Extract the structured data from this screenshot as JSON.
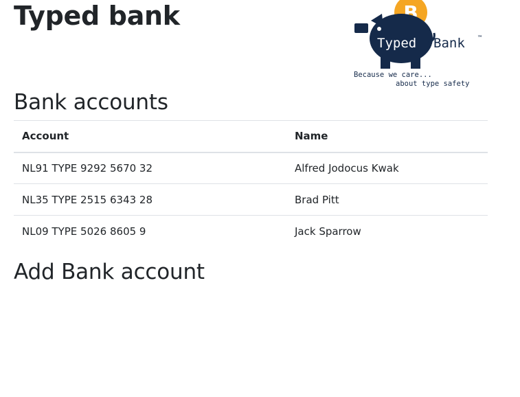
{
  "header": {
    "title": "Typed bank"
  },
  "logo": {
    "coin_symbol": "B",
    "brand_word_1": "Typed",
    "brand_word_2": "Bank",
    "trademark": "™",
    "tagline_line_1": "Because we care...",
    "tagline_line_2": "about type safety",
    "colors": {
      "pig": "#152a4a",
      "coin": "#f5a623"
    }
  },
  "accounts": {
    "title": "Bank accounts",
    "columns": [
      "Account",
      "Name"
    ],
    "rows": [
      {
        "account": "NL91 TYPE 9292 5670 32",
        "name": "Alfred Jodocus Kwak"
      },
      {
        "account": "NL35 TYPE 2515 6343 28",
        "name": "Brad Pitt"
      },
      {
        "account": "NL09 TYPE 5026 8605 9",
        "name": "Jack Sparrow"
      }
    ]
  },
  "add_account": {
    "title": "Add Bank account"
  }
}
